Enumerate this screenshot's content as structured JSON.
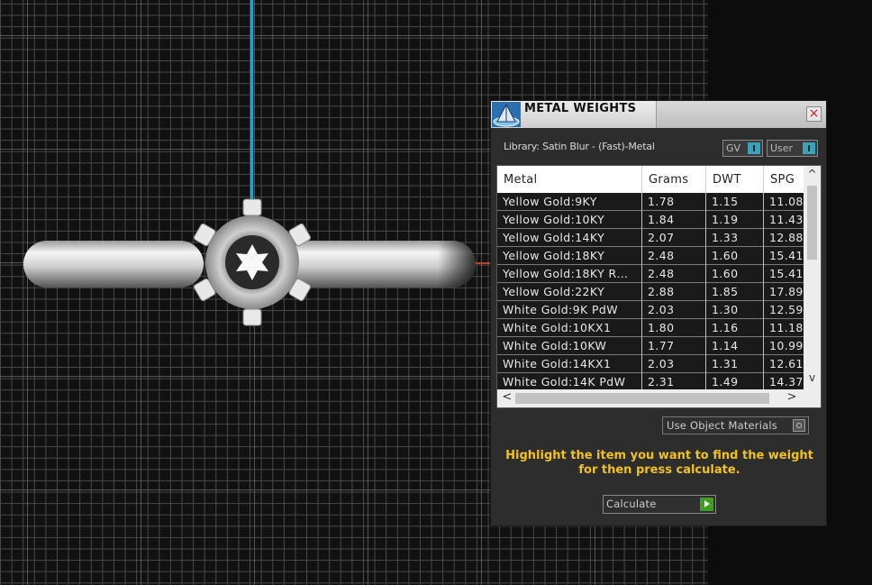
{
  "panel": {
    "title": "METAL WEIGHTS",
    "close_symbol": "×",
    "library_label": "Library: Satin Blur - (Fast)-Metal",
    "gv_label": "GV",
    "user_label": "User",
    "use_object_materials_label": "Use Object Materials",
    "instructions_line1": "Highlight the item you want to find the weight",
    "instructions_line2": "for then press calculate.",
    "calculate_label": "Calculate"
  },
  "table": {
    "headers": [
      "Metal",
      "Grams",
      "DWT",
      "SPG"
    ],
    "rows": [
      [
        "Yellow Gold:9KY",
        "1.78",
        "1.15",
        "11.08"
      ],
      [
        "Yellow Gold:10KY",
        "1.84",
        "1.19",
        "11.43"
      ],
      [
        "Yellow Gold:14KY",
        "2.07",
        "1.33",
        "12.88"
      ],
      [
        "Yellow Gold:18KY",
        "2.48",
        "1.60",
        "15.41"
      ],
      [
        "Yellow Gold:18KY R…",
        "2.48",
        "1.60",
        "15.41"
      ],
      [
        "Yellow Gold:22KY",
        "2.88",
        "1.85",
        "17.89"
      ],
      [
        "White Gold:9K PdW",
        "2.03",
        "1.30",
        "12.59"
      ],
      [
        "White Gold:10KX1",
        "1.80",
        "1.16",
        "11.18"
      ],
      [
        "White Gold:10KW",
        "1.77",
        "1.14",
        "10.99"
      ],
      [
        "White Gold:14KX1",
        "2.03",
        "1.31",
        "12.61"
      ],
      [
        "White Gold:14K PdW",
        "2.31",
        "1.49",
        "14.37"
      ]
    ],
    "scroll_up": "^",
    "scroll_down": "v",
    "scroll_left": "<",
    "scroll_right": ">"
  },
  "icons": {
    "app_logo": "pyramid-logo-icon",
    "close": "close-icon",
    "toggle": "toggle-switch-icon",
    "radio": "radio-icon",
    "play": "play-icon"
  },
  "colors": {
    "instructions_text": "#f2c21a",
    "toggle_accent": "#39a3b8",
    "calculate_accent": "#3f9d1f",
    "axis_vertical": "#22a3c7",
    "axis_horizontal": "#c0401a"
  }
}
